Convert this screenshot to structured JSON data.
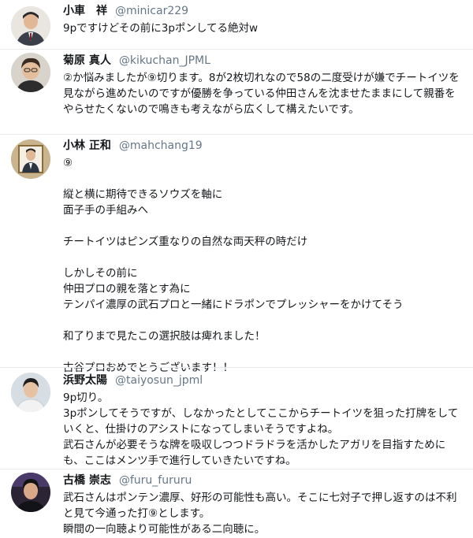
{
  "tweets": [
    {
      "name": "小車　祥",
      "handle": "@minicar229",
      "text": "9pですけどその前に3pポンしてる絶対w"
    },
    {
      "name": "菊原 真人",
      "handle": "@kikuchan_JPML",
      "text": "②か悩みましたが⑨切ります。8が2枚切れなので58の二度受けが嫌でチートイツを見ながら進めたいのですが優勝を争っている仲田さんを沈ませたままにして親番をやらせたくないので鳴きも考えながら広くして構えたいです。"
    },
    {
      "name": "小林 正和",
      "handle": "@mahchang19",
      "text": "⑨\n\n縦と横に期待できるソウズを軸に\n面子手の手組みへ\n\nチートイツはピンズ重なりの自然な両天秤の時だけ\n\nしかしその前に\n仲田プロの親を落とす為に\nテンパイ濃厚の武石プロと一緒にドラポンでプレッシャーをかけてそう\n\n和了りまで見たこの選択肢は痺れました！\n\n古谷プロおめでとうございます！！"
    },
    {
      "name": "浜野太陽",
      "handle": "@taiyosun_jpml",
      "text": "9p切り。\n3pポンしてそうですが、しなかったとしてここからチートイツを狙った打牌をしていくと、仕掛けのアシストになってしまいそうですよね。\n武石さんが必要そうな牌を吸収しつつドラドラを活かしたアガリを目指すためにも、ここはメンツ手で進行していきたいですね。"
    },
    {
      "name": "古橋 崇志",
      "handle": "@furu_fururu",
      "text": "武石さんはポンテン濃厚、好形の可能性も高い。そこに七対子で押し返すのは不利と見て今通った打⑨とします。\n瞬間の一向聴より可能性がある二向聴に。"
    }
  ]
}
